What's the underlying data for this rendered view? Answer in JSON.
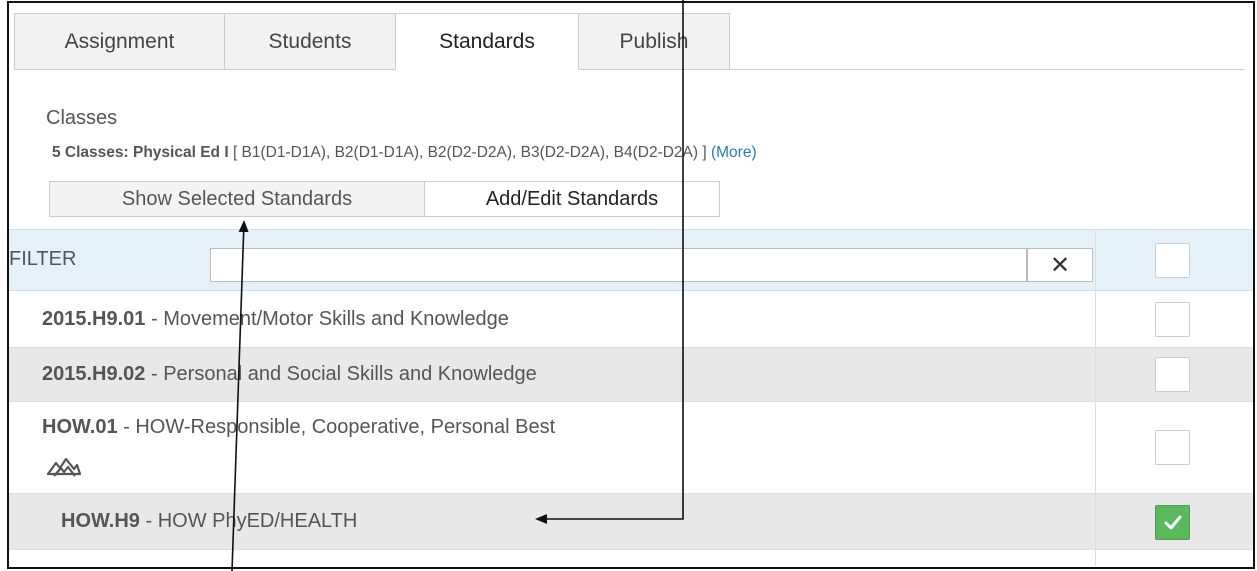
{
  "tabs": [
    {
      "label": "Assignment",
      "active": false
    },
    {
      "label": "Students",
      "active": false
    },
    {
      "label": "Standards",
      "active": true
    },
    {
      "label": "Publish",
      "active": false
    }
  ],
  "classes": {
    "label": "Classes",
    "summary_bold": "5 Classes: Physical Ed I",
    "summary_sections": "[ B1(D1-D1A), B2(D1-D1A), B2(D2-D2A), B3(D2-D2A), B4(D2-D2A) ]",
    "more_link": "(More)"
  },
  "buttons": {
    "show_selected": "Show Selected Standards",
    "add_edit": "Add/Edit Standards"
  },
  "filter": {
    "label": "FILTER",
    "value": "",
    "clear_glyph": "✕",
    "header_checkbox_checked": false
  },
  "standards": [
    {
      "code": "2015.H9.01",
      "separator": " - ",
      "description": "Movement/Motor Skills and Knowledge",
      "checked": false
    },
    {
      "code": "2015.H9.02",
      "separator": " - ",
      "description": "Personal and Social Skills and Knowledge",
      "checked": false
    },
    {
      "code": "HOW.01",
      "separator": " - ",
      "description": "HOW-Responsible, Cooperative, Personal Best",
      "checked": false,
      "icon": "collapse-mountain-icon"
    },
    {
      "code": "HOW.H9",
      "separator": " - ",
      "description": "HOW PhyED/HEALTH",
      "checked": true
    }
  ],
  "colors": {
    "filter_bg": "#e5f1f9",
    "alt_row_bg": "#e8e8e8",
    "link": "#2a7ab8",
    "check_green": "#5cb85c"
  }
}
